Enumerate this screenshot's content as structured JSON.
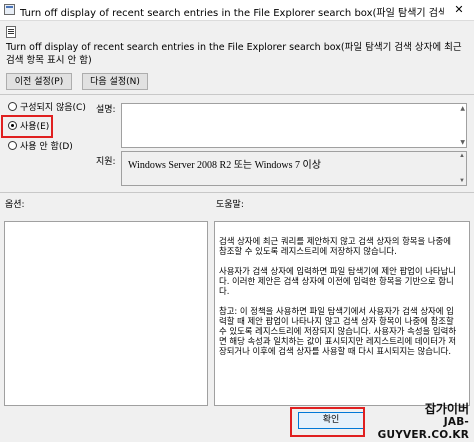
{
  "window": {
    "title": "Turn off display of recent search entries in the File Explorer search box(파일 탐색기 검색 상자...",
    "close_glyph": "✕"
  },
  "heading": "Turn off display of recent search entries in the File Explorer search box(파일 탐색기 검색 상자에 최근 검색 항목 표시 안 함)",
  "nav": {
    "prev_label": "이전 설정(P)",
    "next_label": "다음 설정(N)"
  },
  "radios": [
    {
      "label": "구성되지 않음(C)",
      "checked": false
    },
    {
      "label": "사용(E)",
      "checked": true
    },
    {
      "label": "사용 안 함(D)",
      "checked": false
    }
  ],
  "comment_label": "설명:",
  "supported_label": "지원:",
  "supported_value": "Windows Server 2008 R2 또는 Windows 7 이상",
  "options_label": "옵션:",
  "help_label": "도움말:",
  "help_paragraphs": [
    "검색 상자에 최근 쿼리를 제안하지 않고 검색 상자의 항목을 나중에 참조할 수 있도록 레지스트리에 저장하지 않습니다.",
    "사용자가 검색 상자에 입력하면 파일 탐색기에 제안 팝업이 나타납니다. 이러한 제안은 검색 상자에 이전에 입력한 항목을 기반으로 합니다.",
    "참고: 이 정책을 사용하면 파일 탐색기에서 사용자가 검색 상자에 입력할 때 제안 팝업이 나타나지 않고 검색 상자 항목이 나중에 참조할 수 있도록 레지스트리에 저장되지 않습니다. 사용자가 속성을 입력하면 해당 속성과 일치하는 값이 표시되지만 레지스트리에 데이터가 저장되거나 이후에 검색 상자를 사용할 때 다시 표시되지는 않습니다."
  ],
  "confirm_label": "확인",
  "watermark": {
    "line1": "잡가이버",
    "line2": "JAB-GUYVER.CO.KR"
  },
  "colors": {
    "highlight": "#e02020",
    "accent": "#0078d7"
  }
}
